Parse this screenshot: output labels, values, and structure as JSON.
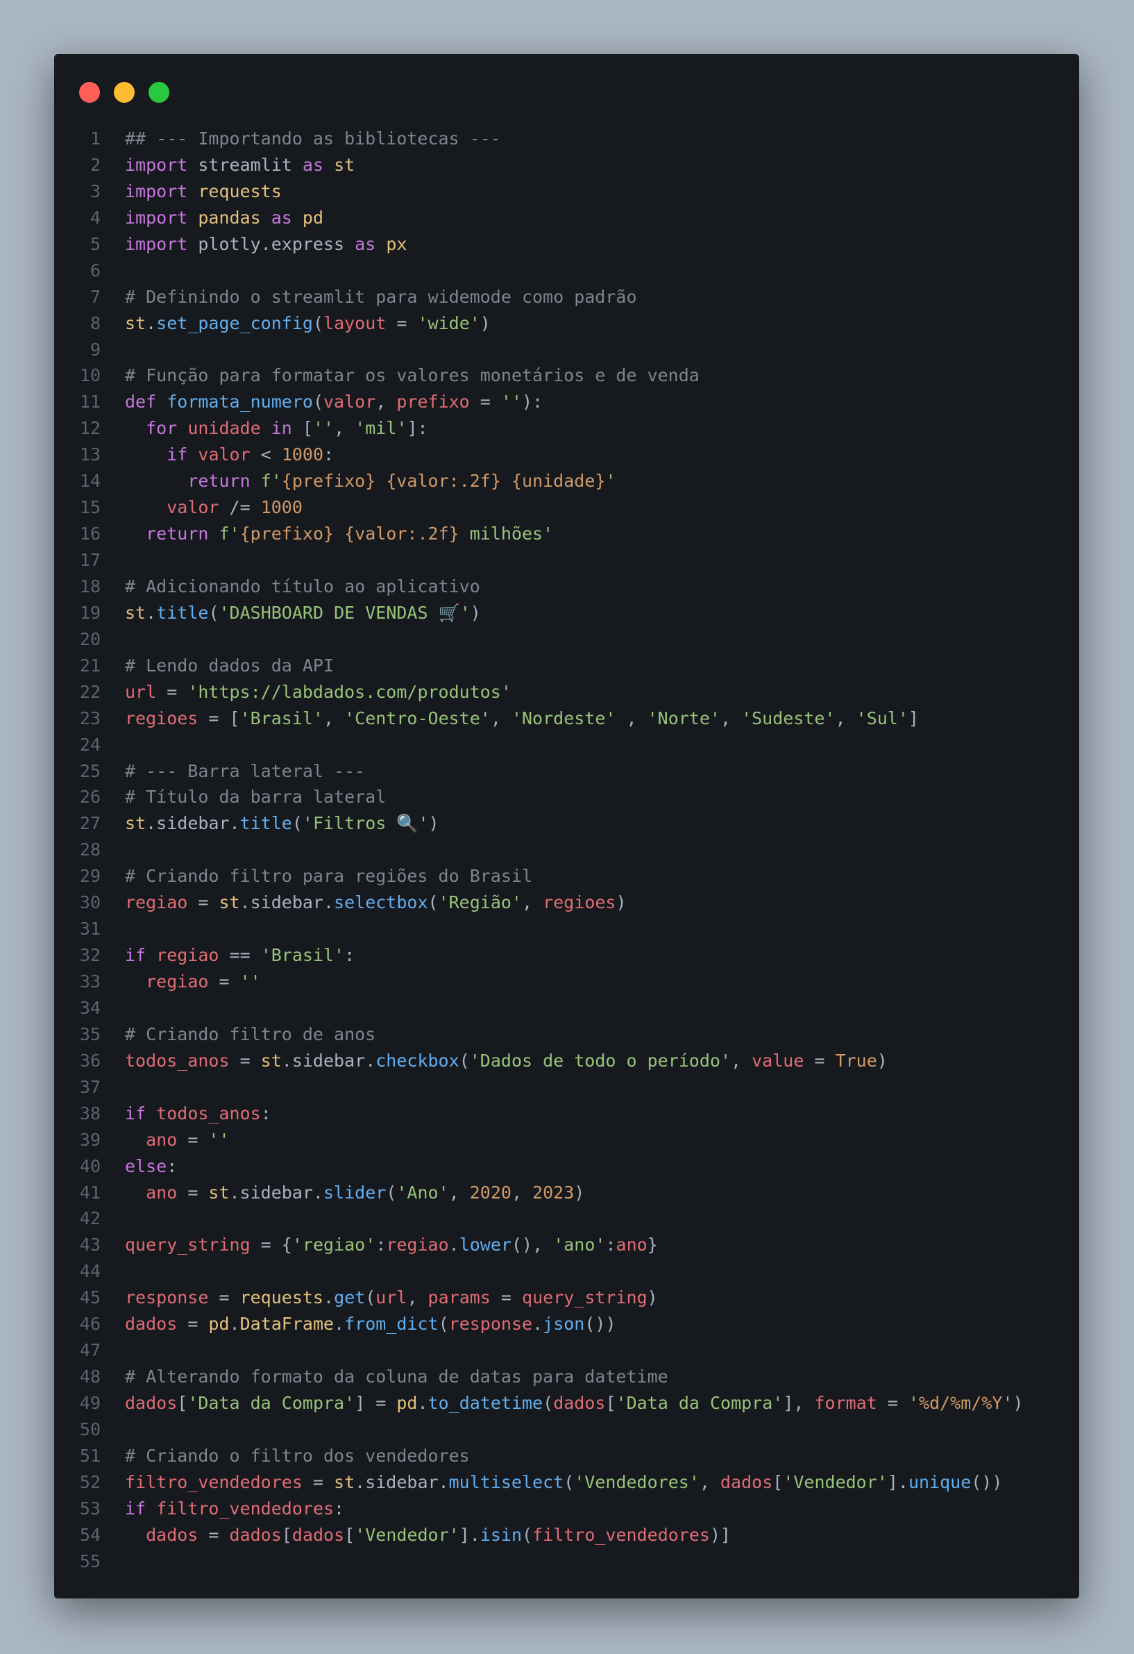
{
  "window": {
    "controls": [
      {
        "name": "close-dot",
        "color": "#ff5f57"
      },
      {
        "name": "minimize-dot",
        "color": "#febc2e"
      },
      {
        "name": "maximize-dot",
        "color": "#28c840"
      }
    ]
  },
  "colors": {
    "background": "#aab6c2",
    "editor": "#16191e",
    "comment": "#7f848e",
    "keyword": "#c678dd",
    "variable": "#e06c75",
    "string": "#98c379",
    "function": "#61afef",
    "number": "#d19a66",
    "module": "#e5c07b",
    "plain": "#abb2bf"
  },
  "code": {
    "lines": [
      {
        "n": "1",
        "t": [
          [
            "c",
            "## --- Importando as bibliotecas ---"
          ]
        ]
      },
      {
        "n": "2",
        "t": [
          [
            "k",
            "import"
          ],
          [
            "p",
            " streamlit "
          ],
          [
            "k",
            "as"
          ],
          [
            "p",
            " "
          ],
          [
            "m",
            "st"
          ]
        ]
      },
      {
        "n": "3",
        "t": [
          [
            "k",
            "import"
          ],
          [
            "p",
            " "
          ],
          [
            "m",
            "requests"
          ]
        ]
      },
      {
        "n": "4",
        "t": [
          [
            "k",
            "import"
          ],
          [
            "p",
            " "
          ],
          [
            "m",
            "pandas"
          ],
          [
            "p",
            " "
          ],
          [
            "k",
            "as"
          ],
          [
            "p",
            " "
          ],
          [
            "m",
            "pd"
          ]
        ]
      },
      {
        "n": "5",
        "t": [
          [
            "k",
            "import"
          ],
          [
            "p",
            " plotly.express "
          ],
          [
            "k",
            "as"
          ],
          [
            "p",
            " "
          ],
          [
            "m",
            "px"
          ]
        ]
      },
      {
        "n": "6",
        "t": []
      },
      {
        "n": "7",
        "t": [
          [
            "c",
            "# Definindo o streamlit para widemode como padrão"
          ]
        ]
      },
      {
        "n": "8",
        "t": [
          [
            "m",
            "st"
          ],
          [
            "p",
            "."
          ],
          [
            "f",
            "set_page_config"
          ],
          [
            "p",
            "("
          ],
          [
            "v",
            "layout"
          ],
          [
            "p",
            " = "
          ],
          [
            "s",
            "'wide'"
          ],
          [
            "p",
            ")"
          ]
        ]
      },
      {
        "n": "9",
        "t": []
      },
      {
        "n": "10",
        "t": [
          [
            "c",
            "# Função para formatar os valores monetários e de venda"
          ]
        ]
      },
      {
        "n": "11",
        "t": [
          [
            "k",
            "def"
          ],
          [
            "p",
            " "
          ],
          [
            "f",
            "formata_numero"
          ],
          [
            "p",
            "("
          ],
          [
            "v",
            "valor"
          ],
          [
            "p",
            ", "
          ],
          [
            "v",
            "prefixo"
          ],
          [
            "p",
            " = "
          ],
          [
            "s",
            "''"
          ],
          [
            "p",
            "):"
          ]
        ]
      },
      {
        "n": "12",
        "t": [
          [
            "p",
            "  "
          ],
          [
            "k",
            "for"
          ],
          [
            "p",
            " "
          ],
          [
            "v",
            "unidade"
          ],
          [
            "p",
            " "
          ],
          [
            "k",
            "in"
          ],
          [
            "p",
            " ["
          ],
          [
            "s",
            "''"
          ],
          [
            "p",
            ", "
          ],
          [
            "s",
            "'mil'"
          ],
          [
            "p",
            "]:"
          ]
        ]
      },
      {
        "n": "13",
        "t": [
          [
            "p",
            "    "
          ],
          [
            "k",
            "if"
          ],
          [
            "p",
            " "
          ],
          [
            "v",
            "valor"
          ],
          [
            "p",
            " < "
          ],
          [
            "n",
            "1000"
          ],
          [
            "p",
            ":"
          ]
        ]
      },
      {
        "n": "14",
        "t": [
          [
            "p",
            "      "
          ],
          [
            "k",
            "return"
          ],
          [
            "p",
            " "
          ],
          [
            "s",
            "f'"
          ],
          [
            "n",
            "{prefixo}"
          ],
          [
            "s",
            " "
          ],
          [
            "n",
            "{valor:.2f}"
          ],
          [
            "s",
            " "
          ],
          [
            "n",
            "{unidade}"
          ],
          [
            "s",
            "'"
          ]
        ]
      },
      {
        "n": "15",
        "t": [
          [
            "p",
            "    "
          ],
          [
            "v",
            "valor"
          ],
          [
            "p",
            " /= "
          ],
          [
            "n",
            "1000"
          ]
        ]
      },
      {
        "n": "16",
        "t": [
          [
            "p",
            "  "
          ],
          [
            "k",
            "return"
          ],
          [
            "p",
            " "
          ],
          [
            "s",
            "f'"
          ],
          [
            "n",
            "{prefixo}"
          ],
          [
            "s",
            " "
          ],
          [
            "n",
            "{valor:.2f}"
          ],
          [
            "s",
            " milhões'"
          ]
        ]
      },
      {
        "n": "17",
        "t": []
      },
      {
        "n": "18",
        "t": [
          [
            "c",
            "# Adicionando título ao aplicativo"
          ]
        ]
      },
      {
        "n": "19",
        "t": [
          [
            "m",
            "st"
          ],
          [
            "p",
            "."
          ],
          [
            "f",
            "title"
          ],
          [
            "p",
            "("
          ],
          [
            "s",
            "'DASHBOARD DE VENDAS 🛒'"
          ],
          [
            "p",
            ")"
          ]
        ]
      },
      {
        "n": "20",
        "t": []
      },
      {
        "n": "21",
        "t": [
          [
            "c",
            "# Lendo dados da API"
          ]
        ]
      },
      {
        "n": "22",
        "t": [
          [
            "v",
            "url"
          ],
          [
            "p",
            " = "
          ],
          [
            "s",
            "'https://labdados.com/produtos'"
          ]
        ]
      },
      {
        "n": "23",
        "t": [
          [
            "v",
            "regioes"
          ],
          [
            "p",
            " = ["
          ],
          [
            "s",
            "'Brasil'"
          ],
          [
            "p",
            ", "
          ],
          [
            "s",
            "'Centro-Oeste'"
          ],
          [
            "p",
            ", "
          ],
          [
            "s",
            "'Nordeste'"
          ],
          [
            "p",
            " , "
          ],
          [
            "s",
            "'Norte'"
          ],
          [
            "p",
            ", "
          ],
          [
            "s",
            "'Sudeste'"
          ],
          [
            "p",
            ", "
          ],
          [
            "s",
            "'Sul'"
          ],
          [
            "p",
            "]"
          ]
        ]
      },
      {
        "n": "24",
        "t": []
      },
      {
        "n": "25",
        "t": [
          [
            "c",
            "# --- Barra lateral ---"
          ]
        ]
      },
      {
        "n": "26",
        "t": [
          [
            "c",
            "# Título da barra lateral"
          ]
        ]
      },
      {
        "n": "27",
        "t": [
          [
            "m",
            "st"
          ],
          [
            "p",
            ".sidebar."
          ],
          [
            "f",
            "title"
          ],
          [
            "p",
            "("
          ],
          [
            "s",
            "'Filtros 🔍'"
          ],
          [
            "p",
            ")"
          ]
        ]
      },
      {
        "n": "28",
        "t": []
      },
      {
        "n": "29",
        "t": [
          [
            "c",
            "# Criando filtro para regiões do Brasil"
          ]
        ]
      },
      {
        "n": "30",
        "t": [
          [
            "v",
            "regiao"
          ],
          [
            "p",
            " = "
          ],
          [
            "m",
            "st"
          ],
          [
            "p",
            ".sidebar."
          ],
          [
            "f",
            "selectbox"
          ],
          [
            "p",
            "("
          ],
          [
            "s",
            "'Região'"
          ],
          [
            "p",
            ", "
          ],
          [
            "v",
            "regioes"
          ],
          [
            "p",
            ")"
          ]
        ]
      },
      {
        "n": "31",
        "t": []
      },
      {
        "n": "32",
        "t": [
          [
            "k",
            "if"
          ],
          [
            "p",
            " "
          ],
          [
            "v",
            "regiao"
          ],
          [
            "p",
            " == "
          ],
          [
            "s",
            "'Brasil'"
          ],
          [
            "p",
            ":"
          ]
        ]
      },
      {
        "n": "33",
        "t": [
          [
            "p",
            "  "
          ],
          [
            "v",
            "regiao"
          ],
          [
            "p",
            " = "
          ],
          [
            "s",
            "''"
          ]
        ]
      },
      {
        "n": "34",
        "t": []
      },
      {
        "n": "35",
        "t": [
          [
            "c",
            "# Criando filtro de anos"
          ]
        ]
      },
      {
        "n": "36",
        "t": [
          [
            "v",
            "todos_anos"
          ],
          [
            "p",
            " = "
          ],
          [
            "m",
            "st"
          ],
          [
            "p",
            ".sidebar."
          ],
          [
            "f",
            "checkbox"
          ],
          [
            "p",
            "("
          ],
          [
            "s",
            "'Dados de todo o período'"
          ],
          [
            "p",
            ", "
          ],
          [
            "v",
            "value"
          ],
          [
            "p",
            " = "
          ],
          [
            "n",
            "True"
          ],
          [
            "p",
            ")"
          ]
        ]
      },
      {
        "n": "37",
        "t": []
      },
      {
        "n": "38",
        "t": [
          [
            "k",
            "if"
          ],
          [
            "p",
            " "
          ],
          [
            "v",
            "todos_anos"
          ],
          [
            "p",
            ":"
          ]
        ]
      },
      {
        "n": "39",
        "t": [
          [
            "p",
            "  "
          ],
          [
            "v",
            "ano"
          ],
          [
            "p",
            " = "
          ],
          [
            "s",
            "''"
          ]
        ]
      },
      {
        "n": "40",
        "t": [
          [
            "k",
            "else"
          ],
          [
            "p",
            ":"
          ]
        ]
      },
      {
        "n": "41",
        "t": [
          [
            "p",
            "  "
          ],
          [
            "v",
            "ano"
          ],
          [
            "p",
            " = "
          ],
          [
            "m",
            "st"
          ],
          [
            "p",
            ".sidebar."
          ],
          [
            "f",
            "slider"
          ],
          [
            "p",
            "("
          ],
          [
            "s",
            "'Ano'"
          ],
          [
            "p",
            ", "
          ],
          [
            "n",
            "2020"
          ],
          [
            "p",
            ", "
          ],
          [
            "n",
            "2023"
          ],
          [
            "p",
            ")"
          ]
        ]
      },
      {
        "n": "42",
        "t": []
      },
      {
        "n": "43",
        "t": [
          [
            "v",
            "query_string"
          ],
          [
            "p",
            " = {"
          ],
          [
            "s",
            "'regiao'"
          ],
          [
            "p",
            ":"
          ],
          [
            "v",
            "regiao"
          ],
          [
            "p",
            "."
          ],
          [
            "f",
            "lower"
          ],
          [
            "p",
            "(), "
          ],
          [
            "s",
            "'ano'"
          ],
          [
            "p",
            ":"
          ],
          [
            "v",
            "ano"
          ],
          [
            "p",
            "}"
          ]
        ]
      },
      {
        "n": "44",
        "t": []
      },
      {
        "n": "45",
        "t": [
          [
            "v",
            "response"
          ],
          [
            "p",
            " = "
          ],
          [
            "m",
            "requests"
          ],
          [
            "p",
            "."
          ],
          [
            "f",
            "get"
          ],
          [
            "p",
            "("
          ],
          [
            "v",
            "url"
          ],
          [
            "p",
            ", "
          ],
          [
            "v",
            "params"
          ],
          [
            "p",
            " = "
          ],
          [
            "v",
            "query_string"
          ],
          [
            "p",
            ")"
          ]
        ]
      },
      {
        "n": "46",
        "t": [
          [
            "v",
            "dados"
          ],
          [
            "p",
            " = "
          ],
          [
            "m",
            "pd"
          ],
          [
            "p",
            "."
          ],
          [
            "m",
            "DataFrame"
          ],
          [
            "p",
            "."
          ],
          [
            "f",
            "from_dict"
          ],
          [
            "p",
            "("
          ],
          [
            "v",
            "response"
          ],
          [
            "p",
            "."
          ],
          [
            "f",
            "json"
          ],
          [
            "p",
            "())"
          ]
        ]
      },
      {
        "n": "47",
        "t": []
      },
      {
        "n": "48",
        "t": [
          [
            "c",
            "# Alterando formato da coluna de datas para datetime"
          ]
        ]
      },
      {
        "n": "49",
        "t": [
          [
            "v",
            "dados"
          ],
          [
            "p",
            "["
          ],
          [
            "s",
            "'Data da Compra'"
          ],
          [
            "p",
            "] = "
          ],
          [
            "m",
            "pd"
          ],
          [
            "p",
            "."
          ],
          [
            "f",
            "to_datetime"
          ],
          [
            "p",
            "("
          ],
          [
            "v",
            "dados"
          ],
          [
            "p",
            "["
          ],
          [
            "s",
            "'Data da Compra'"
          ],
          [
            "p",
            "], "
          ],
          [
            "v",
            "format"
          ],
          [
            "p",
            " = "
          ],
          [
            "s",
            "'"
          ],
          [
            "n",
            "%d/%m/%Y"
          ],
          [
            "s",
            "'"
          ],
          [
            "p",
            ")"
          ]
        ]
      },
      {
        "n": "50",
        "t": []
      },
      {
        "n": "51",
        "t": [
          [
            "c",
            "# Criando o filtro dos vendedores"
          ]
        ]
      },
      {
        "n": "52",
        "t": [
          [
            "v",
            "filtro_vendedores"
          ],
          [
            "p",
            " = "
          ],
          [
            "m",
            "st"
          ],
          [
            "p",
            ".sidebar."
          ],
          [
            "f",
            "multiselect"
          ],
          [
            "p",
            "("
          ],
          [
            "s",
            "'Vendedores'"
          ],
          [
            "p",
            ", "
          ],
          [
            "v",
            "dados"
          ],
          [
            "p",
            "["
          ],
          [
            "s",
            "'Vendedor'"
          ],
          [
            "p",
            "]."
          ],
          [
            "f",
            "unique"
          ],
          [
            "p",
            "())"
          ]
        ]
      },
      {
        "n": "53",
        "t": [
          [
            "k",
            "if"
          ],
          [
            "p",
            " "
          ],
          [
            "v",
            "filtro_vendedores"
          ],
          [
            "p",
            ":"
          ]
        ]
      },
      {
        "n": "54",
        "t": [
          [
            "p",
            "  "
          ],
          [
            "v",
            "dados"
          ],
          [
            "p",
            " = "
          ],
          [
            "v",
            "dados"
          ],
          [
            "p",
            "["
          ],
          [
            "v",
            "dados"
          ],
          [
            "p",
            "["
          ],
          [
            "s",
            "'Vendedor'"
          ],
          [
            "p",
            "]."
          ],
          [
            "f",
            "isin"
          ],
          [
            "p",
            "("
          ],
          [
            "v",
            "filtro_vendedores"
          ],
          [
            "p",
            ")]"
          ]
        ]
      },
      {
        "n": "55",
        "t": []
      }
    ]
  }
}
